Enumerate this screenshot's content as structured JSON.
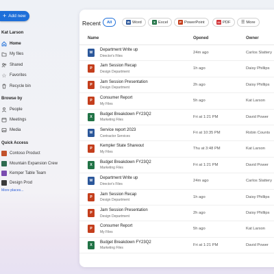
{
  "sidebar": {
    "add_label": "Add new",
    "user_name": "Kat Larson",
    "nav": [
      {
        "label": "Home",
        "icon": "home-icon",
        "active": true
      },
      {
        "label": "My files",
        "icon": "folder-icon"
      },
      {
        "label": "Shared",
        "icon": "people-icon"
      },
      {
        "label": "Favorites",
        "icon": "star-icon"
      },
      {
        "label": "Recycle bin",
        "icon": "trash-icon"
      }
    ],
    "browse_title": "Browse by",
    "browse": [
      {
        "label": "People",
        "icon": "person-icon"
      },
      {
        "label": "Meetings",
        "icon": "calendar-icon"
      },
      {
        "label": "Media",
        "icon": "image-icon"
      }
    ],
    "quick_title": "Quick Access",
    "quick": [
      {
        "label": "Contoso Product",
        "color": "#c2522b"
      },
      {
        "label": "Mountain Expansion Crew",
        "color": "#2e6b4f"
      },
      {
        "label": "Kemper Table Team",
        "color": "#7a4bb0"
      },
      {
        "label": "Design Prod",
        "color": "#3a3a3a"
      }
    ],
    "more_places": "More places..."
  },
  "main": {
    "title": "Recent",
    "filters": [
      {
        "label": "All",
        "active": true
      },
      {
        "label": "Word",
        "icon": "word-icon",
        "color": "#2b579a",
        "letter": "W"
      },
      {
        "label": "Excel",
        "icon": "excel-icon",
        "color": "#217346",
        "letter": "X"
      },
      {
        "label": "PowerPoint",
        "icon": "powerpoint-icon",
        "color": "#c43e1c",
        "letter": "P"
      },
      {
        "label": "PDF",
        "icon": "pdf-icon",
        "color": "#d13438",
        "letter": "▭"
      },
      {
        "label": "More",
        "icon": "filter-icon"
      }
    ],
    "columns": {
      "name": "Name",
      "opened": "Opened",
      "owner": "Owner"
    },
    "files": [
      {
        "name": "Department Write up",
        "location": "Director's Files",
        "opened": "24m ago",
        "owner": "Carlos Slattery",
        "type": "word"
      },
      {
        "name": "Jam Session Recap",
        "location": "Design Department",
        "opened": "1h ago",
        "owner": "Daisy Phillips",
        "type": "powerpoint"
      },
      {
        "name": "Jam Session Presentation",
        "location": "Design Department",
        "opened": "2h ago",
        "owner": "Daisy Phillips",
        "type": "powerpoint"
      },
      {
        "name": "Consumer Report",
        "location": "My Files",
        "opened": "5h ago",
        "owner": "Kat Larson",
        "type": "powerpoint"
      },
      {
        "name": "Budget Breakdown FY23Q2",
        "location": "Marketing Files",
        "opened": "Fri at 1:21 PM",
        "owner": "David Power",
        "type": "excel"
      },
      {
        "name": "Service report 2023",
        "location": "Contractor Services",
        "opened": "Fri at 10:35 PM",
        "owner": "Robin Counts",
        "type": "word"
      },
      {
        "name": "Kempler State Shareout",
        "location": "My Files",
        "opened": "Thu at 3:48 PM",
        "owner": "Kat Larson",
        "type": "powerpoint"
      },
      {
        "name": "Budget Breakdown FY23Q2",
        "location": "Marketing Files",
        "opened": "Fri at 1:21 PM",
        "owner": "David Power",
        "type": "excel"
      },
      {
        "name": "Department Write up",
        "location": "Director's Files",
        "opened": "24m ago",
        "owner": "Carlos Slattery",
        "type": "word"
      },
      {
        "name": "Jam Session Recap",
        "location": "Design Department",
        "opened": "1h ago",
        "owner": "Daisy Phillips",
        "type": "powerpoint"
      },
      {
        "name": "Jam Session Presentation",
        "location": "Design Department",
        "opened": "2h ago",
        "owner": "Daisy Phillips",
        "type": "powerpoint"
      },
      {
        "name": "Consumer Report",
        "location": "My Files",
        "opened": "5h ago",
        "owner": "Kat Larson",
        "type": "powerpoint"
      },
      {
        "name": "Budget Breakdown FY23Q2",
        "location": "Marketing Files",
        "opened": "Fri at 1:21 PM",
        "owner": "David Power",
        "type": "excel"
      }
    ]
  },
  "colors": {
    "accent": "#1e6fd9",
    "word": "#2b579a",
    "excel": "#217346",
    "powerpoint": "#c43e1c"
  }
}
